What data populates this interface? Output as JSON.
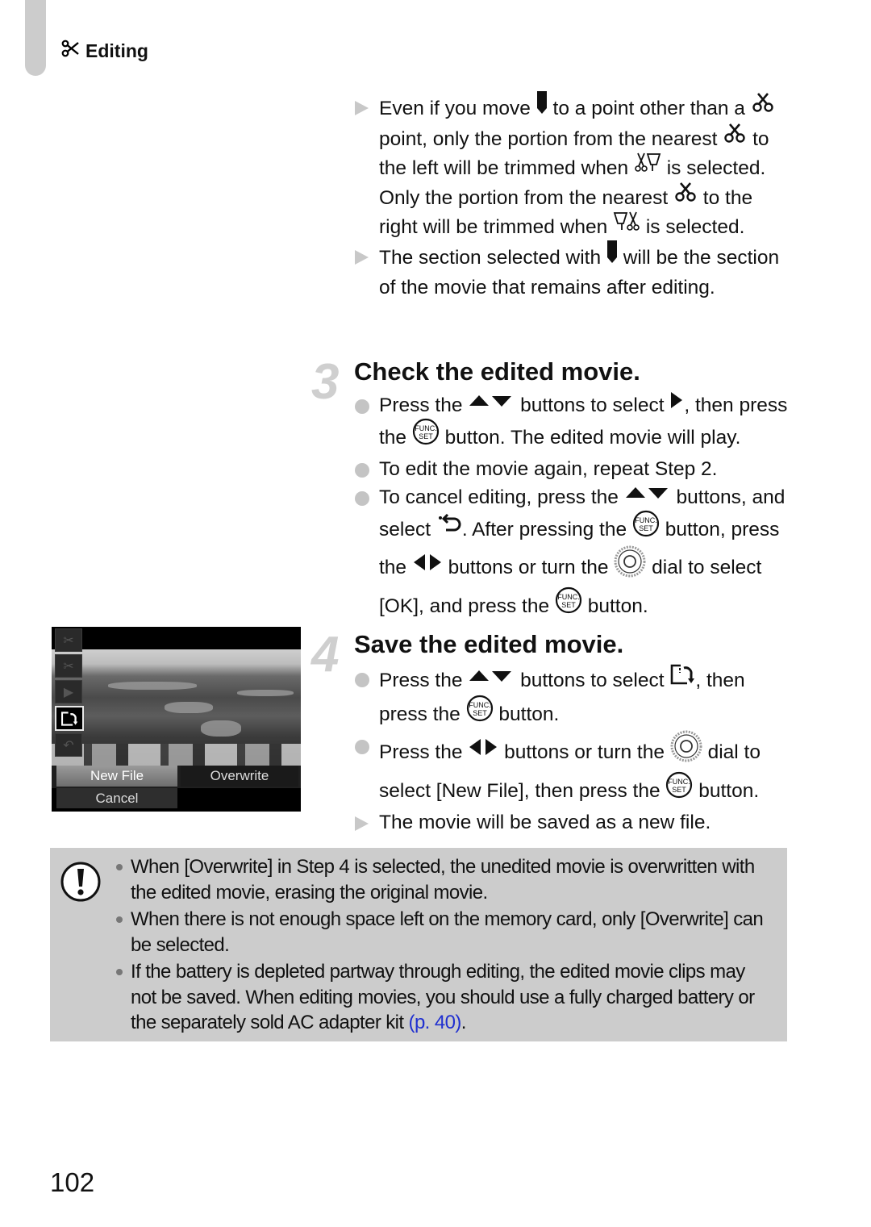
{
  "header": {
    "section_icon": "scissors-icon",
    "section_title": "Editing"
  },
  "trim_notes": [
    {
      "marker": "result-triangle",
      "parts": [
        "Even if you move ",
        "{marker-icon}",
        " to a point other than a ",
        "{scissors-icon}",
        " point, only the portion from the nearest ",
        "{scissors-icon}",
        " to the left will be trimmed when ",
        "{trim-left-icon}",
        " is selected. Only the portion from the nearest ",
        "{scissors-icon}",
        " to the right will be trimmed when ",
        "{trim-right-icon}",
        " is selected."
      ]
    },
    {
      "marker": "result-triangle",
      "parts": [
        "The section selected with ",
        "{marker-icon}",
        " will be the section of the movie that remains after editing."
      ]
    }
  ],
  "steps": [
    {
      "number": "3",
      "title": "Check the edited movie.",
      "items": [
        {
          "marker": "dot",
          "text_a": "Press the ",
          "text_b": " buttons to select ",
          "text_c": ", then press the ",
          "text_d": " button. The edited movie will play."
        },
        {
          "marker": "dot",
          "text": "To edit the movie again, repeat Step 2."
        },
        {
          "marker": "dot",
          "text_a": "To cancel editing, press the ",
          "text_b": " buttons, and select ",
          "text_c": ". After pressing the ",
          "text_d": " button, press the ",
          "text_e": " buttons or turn the ",
          "text_f": " dial to select [OK], and press the ",
          "text_g": " button."
        }
      ]
    },
    {
      "number": "4",
      "title": "Save the edited movie.",
      "items": [
        {
          "marker": "dot",
          "text_a": "Press the ",
          "text_b": " buttons to select ",
          "text_c": ", then press the ",
          "text_d": " button."
        },
        {
          "marker": "dot",
          "text_a": "Press the ",
          "text_b": " buttons or turn the ",
          "text_c": " dial to select [New File], then press the ",
          "text_d": " button."
        },
        {
          "marker": "result-triangle",
          "text": "The movie will be saved as a new file."
        }
      ]
    }
  ],
  "camera_screen": {
    "side_icons": [
      "trim-left-icon",
      "trim-right-icon",
      "play-icon",
      "save-icon",
      "cancel-return-icon"
    ],
    "selected_icon": "save-icon",
    "options": {
      "new_file": "New File",
      "overwrite": "Overwrite",
      "cancel": "Cancel"
    },
    "selected_option": "New File"
  },
  "caution": {
    "icon": "caution-icon",
    "items": [
      "When [Overwrite] in Step 4 is selected, the unedited movie is overwritten with the edited movie, erasing the original movie.",
      "When there is not enough space left on the memory card, only [Overwrite] can be selected.",
      "If the battery is depleted partway through editing, the edited movie clips may not be saved. When editing movies, you should use a fully charged battery or the separately sold AC adapter kit "
    ],
    "link_text": "(p. 40)",
    "link_color": "#2030d0",
    "trailing": "."
  },
  "page_number": "102"
}
